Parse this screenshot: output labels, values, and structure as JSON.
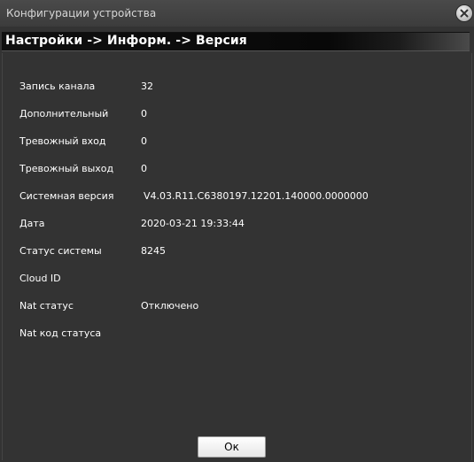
{
  "window": {
    "title": "Конфигурации устройства",
    "breadcrumb": "Настройки -> Информ. -> Версия"
  },
  "info_rows": [
    {
      "label": "Запись канала",
      "value": "32"
    },
    {
      "label": "Дополнительный",
      "value": "0"
    },
    {
      "label": "Тревожный вход",
      "value": "0"
    },
    {
      "label": "Тревожный выход",
      "value": "0"
    },
    {
      "label": "Системная версия",
      "value": "V4.03.R11.C6380197.12201.140000.0000000"
    },
    {
      "label": "Дата",
      "value": "2020-03-21 19:33:44"
    },
    {
      "label": "Статус системы",
      "value": "8245"
    },
    {
      "label": "Cloud ID",
      "value": ""
    },
    {
      "label": "Nat статус",
      "value": "Отключено"
    },
    {
      "label": "Nat код статуса",
      "value": ""
    }
  ],
  "buttons": {
    "ok_label": "Ок"
  },
  "icons": {
    "close": "close-icon"
  },
  "colors": {
    "background": "#333333",
    "text": "#ffffff"
  }
}
